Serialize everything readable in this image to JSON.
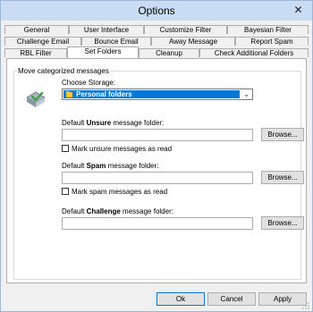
{
  "window": {
    "title": "Options",
    "close_glyph": "✕"
  },
  "tabs": {
    "row1": [
      "General",
      "User Interface",
      "Customize Filter",
      "Bayesian Filter"
    ],
    "row2": [
      "Challenge Email",
      "Bounce Email",
      "Away Message",
      "Report Spam"
    ],
    "row3": [
      "RBL Filter",
      "Set Folders",
      "Cleanup",
      "Check Additional Folders"
    ]
  },
  "panel": {
    "group_title": "Move categorized messages",
    "storage_label": "Choose Storage:",
    "storage_value": "Personal folders",
    "unsure": {
      "prefix": "Default ",
      "bold": "Unsure",
      "suffix": " message folder:",
      "checkbox": "Mark unsure messages as read"
    },
    "spam": {
      "prefix": "Default ",
      "bold": "Spam",
      "suffix": " message folder:",
      "checkbox": "Mark spam messages as read"
    },
    "challenge": {
      "prefix": "Default ",
      "bold": "Challenge",
      "suffix": " message folder:"
    },
    "browse_label": "Browse..."
  },
  "buttons": {
    "ok": "Ok",
    "cancel": "Cancel",
    "apply": "Apply"
  },
  "icons": {
    "logo": "shield-flag-icon",
    "storage": "personal-folders-icon",
    "dropdown": "chevron-down-icon"
  }
}
